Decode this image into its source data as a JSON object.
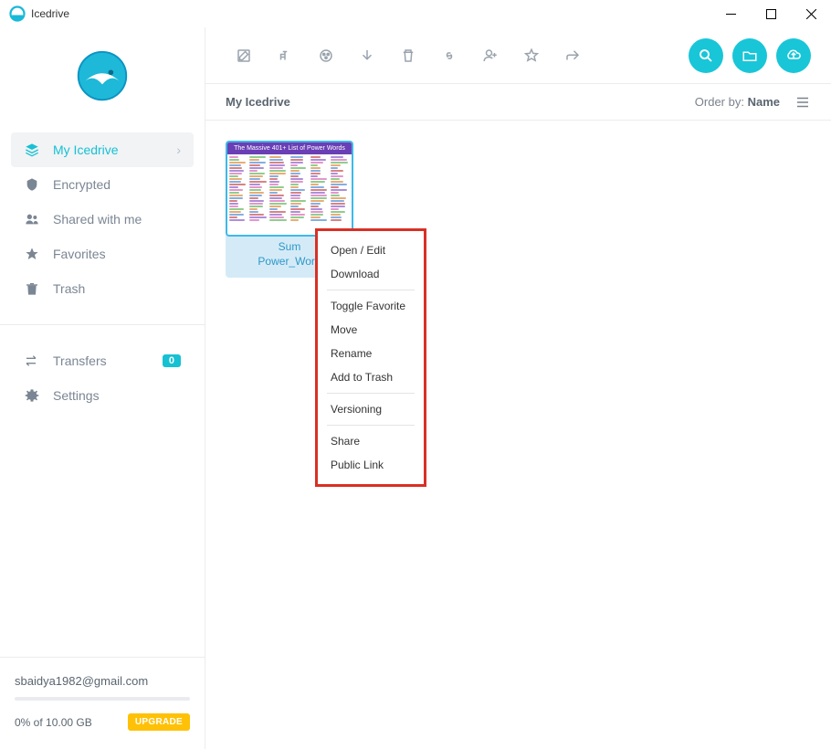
{
  "titlebar": {
    "title": "Icedrive"
  },
  "sidebar": {
    "nav": [
      {
        "label": "My Icedrive",
        "active": true,
        "chevron": true
      },
      {
        "label": "Encrypted"
      },
      {
        "label": "Shared with me"
      },
      {
        "label": "Favorites"
      },
      {
        "label": "Trash"
      }
    ],
    "secondary": [
      {
        "label": "Transfers",
        "badge": "0"
      },
      {
        "label": "Settings"
      }
    ],
    "user_email": "sbaidya1982@gmail.com",
    "storage_text": "0% of 10.00 GB",
    "upgrade_label": "UPGRADE"
  },
  "breadcrumb": "My Icedrive",
  "order_by": {
    "prefix": "Order by: ",
    "value": "Name"
  },
  "file": {
    "thumb_title": "The Massive 401+ List of Power Words",
    "name_line1": "Sum",
    "name_line2": "Power_Word"
  },
  "context_menu": {
    "groups": [
      [
        "Open / Edit",
        "Download"
      ],
      [
        "Toggle Favorite",
        "Move",
        "Rename",
        "Add to Trash"
      ],
      [
        "Versioning"
      ],
      [
        "Share",
        "Public Link"
      ]
    ]
  }
}
